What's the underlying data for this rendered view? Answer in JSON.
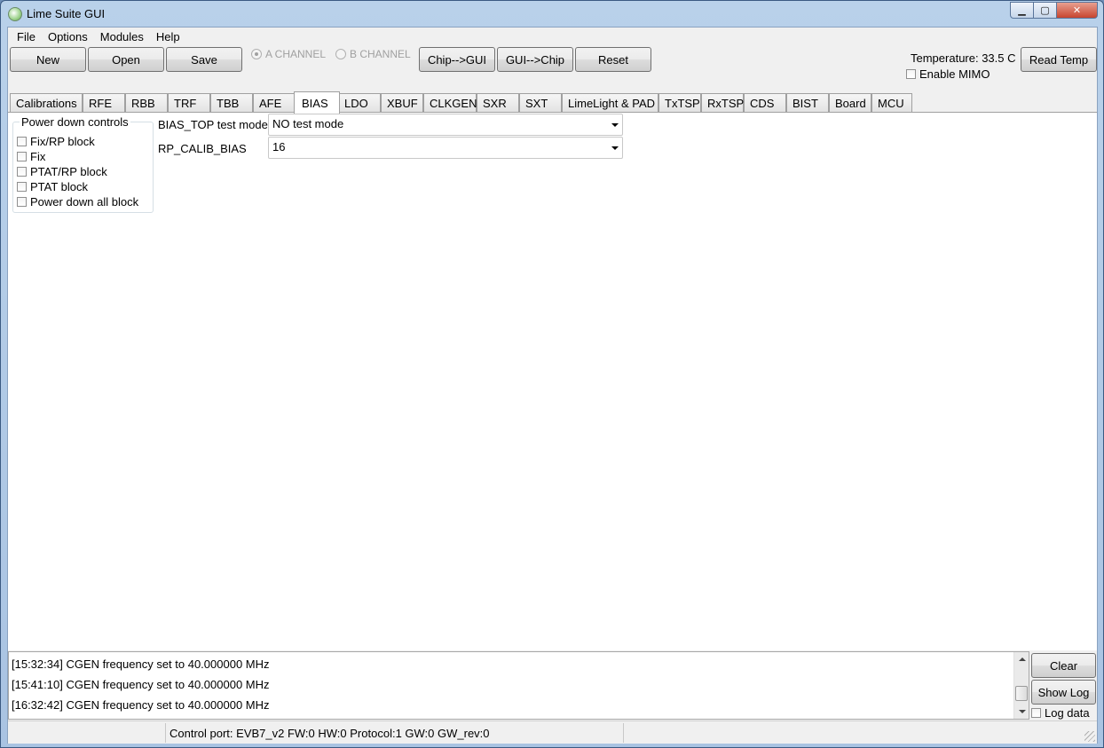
{
  "window": {
    "title": "Lime Suite GUI",
    "min_glyph": "▁",
    "max_glyph": "▢",
    "close_glyph": "✕"
  },
  "menu": [
    "File",
    "Options",
    "Modules",
    "Help"
  ],
  "toolbar": {
    "new": "New",
    "open": "Open",
    "save": "Save",
    "channel_a": "A CHANNEL",
    "channel_b": "B CHANNEL",
    "chip_to_gui": "Chip-->GUI",
    "gui_to_chip": "GUI-->Chip",
    "reset": "Reset",
    "temperature": "Temperature: 33.5 C",
    "enable_mimo": "Enable MIMO",
    "read_temp": "Read Temp"
  },
  "tabs": [
    "Calibrations",
    "RFE",
    "RBB",
    "TRF",
    "TBB",
    "AFE",
    "BIAS",
    "LDO",
    "XBUF",
    "CLKGEN",
    "SXR",
    "SXT",
    "LimeLight & PAD",
    "TxTSP",
    "RxTSP",
    "CDS",
    "BIST",
    "Board",
    "MCU"
  ],
  "active_tab": "BIAS",
  "power_down": {
    "title": "Power down controls",
    "items": [
      "Fix/RP block",
      "Fix",
      "PTAT/RP block",
      "PTAT block",
      "Power down all block"
    ]
  },
  "bias_top": {
    "label": "BIAS_TOP test mode",
    "value": "NO test mode"
  },
  "rp_calib": {
    "label": "RP_CALIB_BIAS",
    "value": "16"
  },
  "log": {
    "lines": [
      "[15:32:34] CGEN frequency set to 40.000000 MHz",
      "[15:41:10] CGEN frequency set to 40.000000 MHz",
      "[16:32:42] CGEN frequency set to 40.000000 MHz"
    ],
    "clear": "Clear",
    "show_log": "Show Log",
    "log_data": "Log data"
  },
  "status": {
    "control_port": "Control port: EVB7_v2 FW:0 HW:0 Protocol:1 GW:0 GW_rev:0"
  }
}
